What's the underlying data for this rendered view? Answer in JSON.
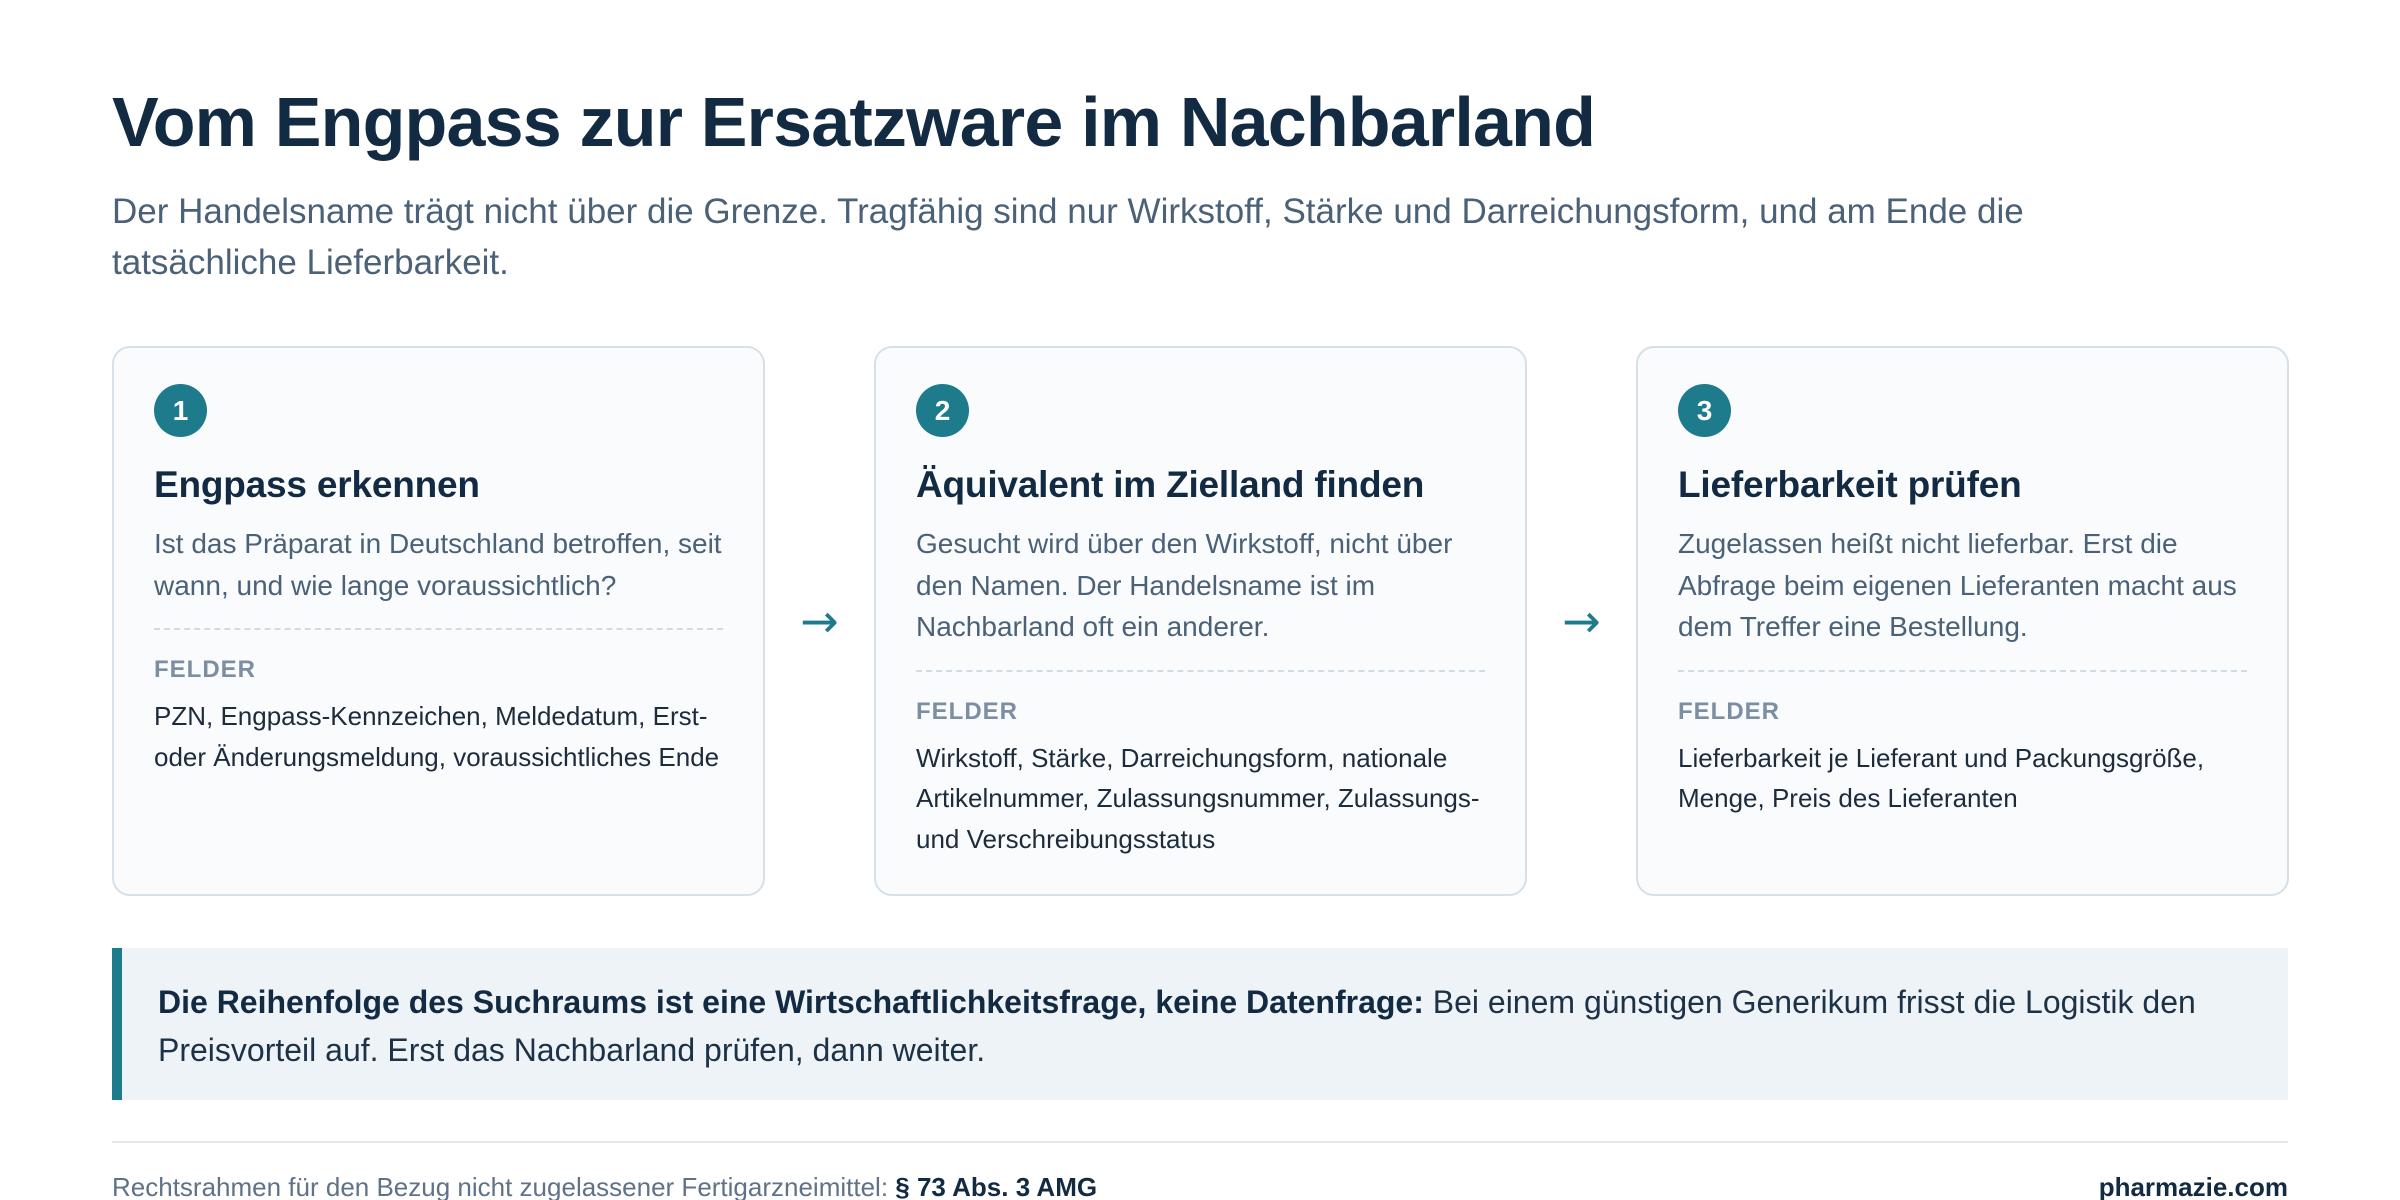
{
  "header": {
    "title": "Vom Engpass zur Ersatzware im Nachbarland",
    "subtitle": "Der Handelsname trägt nicht über die Grenze. Tragfähig sind nur Wirkstoff, Stärke und Darreichungsform, und am Ende die tatsächliche Lieferbarkeit."
  },
  "steps": [
    {
      "number": "1",
      "title": "Engpass erkennen",
      "description": "Ist das Präparat in Deutschland betroffen, seit wann, und wie lange voraussichtlich?",
      "fields_label": "FELDER",
      "fields": "PZN, Engpass-Kennzeichen, Meldedatum, Erst- oder Änderungsmeldung, voraussichtliches Ende"
    },
    {
      "number": "2",
      "title": "Äquivalent im Zielland finden",
      "description": "Gesucht wird über den Wirkstoff, nicht über den Namen. Der Handelsname ist im Nachbarland oft ein anderer.",
      "fields_label": "FELDER",
      "fields": "Wirkstoff, Stärke, Darreichungsform, nationale Artikelnummer, Zulassungsnummer, Zulassungs- und Verschreibungsstatus"
    },
    {
      "number": "3",
      "title": "Lieferbarkeit prüfen",
      "description": "Zugelassen heißt nicht lieferbar. Erst die Abfrage beim eigenen Lieferanten macht aus dem Treffer eine Bestellung.",
      "fields_label": "FELDER",
      "fields": "Lieferbarkeit je Lieferant und Packungsgröße, Menge, Preis des Lieferanten"
    }
  ],
  "arrows": [
    "→",
    "→"
  ],
  "callout": {
    "bold": "Die Reihenfolge des Suchraums ist eine Wirtschaftlichkeitsfrage, keine Datenfrage:",
    "text": " Bei einem günstigen Generikum frisst die Logistik den Preisvorteil auf. Erst das Nachbarland prüfen, dann weiter."
  },
  "footer": {
    "left_text": "Rechtsrahmen für den Bezug nicht zugelassener Fertigarzneimittel: ",
    "left_bold": "§ 73 Abs. 3 AMG",
    "right": "pharmazie.com"
  },
  "colors": {
    "accent": "#1e7b8c",
    "heading": "#132a43",
    "muted": "#4b6178",
    "card_border": "#d6e0e8",
    "callout_bg": "#edf3f7"
  }
}
